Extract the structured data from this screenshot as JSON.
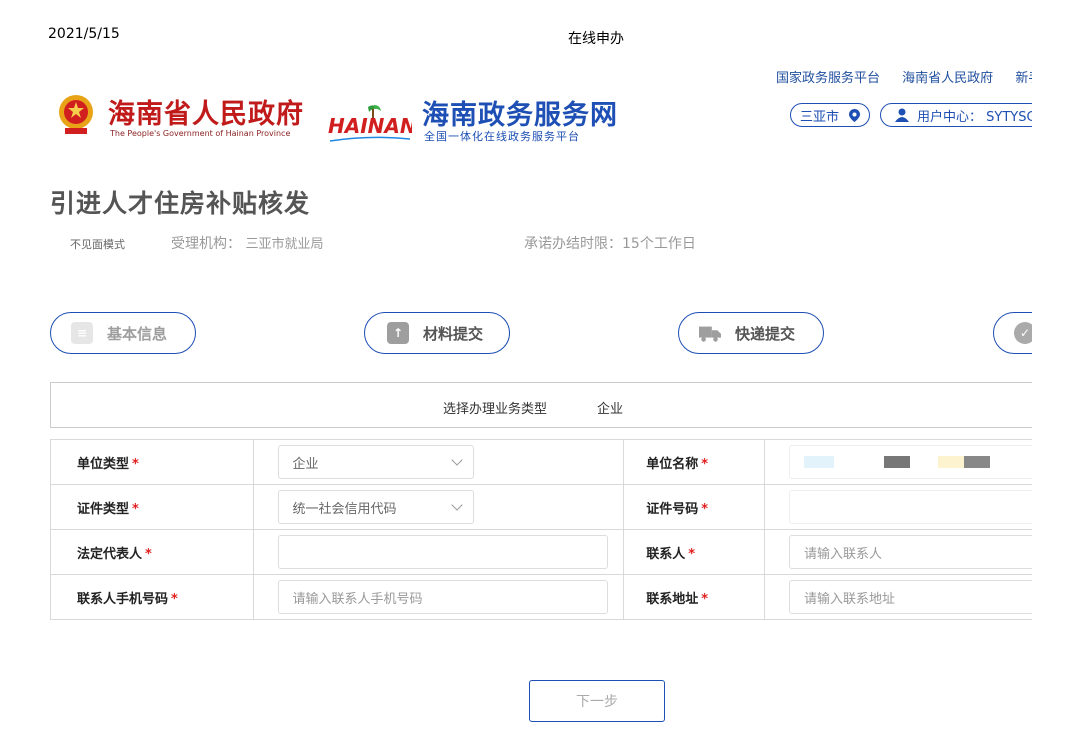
{
  "print_header": {
    "date": "2021/5/15",
    "title": "在线申办"
  },
  "top_links": [
    "国家政务服务平台",
    "海南省人民政府",
    "新手"
  ],
  "gov_logo": {
    "title_cn": "海南省人民政府",
    "title_en": "The People's Government of Hainan Province"
  },
  "portal_logo": {
    "title": "海南政务服务网",
    "subtitle": "全国一体化在线政务服务平台",
    "logo_text": "HAINAN"
  },
  "city_button": "三亚市",
  "user_center": "用户中心： SYTYSC",
  "service": {
    "title": "引进人才住房补贴核发",
    "mode": "不见面模式",
    "org_label": "受理机构：",
    "org_value": "三亚市就业局",
    "time_limit": "承诺办结时限：15个工作日"
  },
  "steps": [
    "基本信息",
    "材料提交",
    "快递提交",
    ""
  ],
  "business_type": {
    "label": "选择办理业务类型",
    "value": "企业"
  },
  "form": {
    "unit_type": {
      "label": "单位类型",
      "value": "企业"
    },
    "unit_name": {
      "label": "单位名称",
      "value": ""
    },
    "cert_type": {
      "label": "证件类型",
      "value": "统一社会信用代码"
    },
    "cert_number": {
      "label": "证件号码",
      "value": ""
    },
    "legal_rep": {
      "label": "法定代表人",
      "value": ""
    },
    "contact": {
      "label": "联系人",
      "placeholder": "请输入联系人"
    },
    "contact_phone": {
      "label": "联系人手机号码",
      "placeholder": "请输入联系人手机号码"
    },
    "contact_address": {
      "label": "联系地址",
      "placeholder": "请输入联系地址"
    }
  },
  "required_mark": "*",
  "next_button": "下一步",
  "colors": {
    "brand_blue": "#1e4fb4",
    "gov_red": "#c01a1a",
    "required": "#e02020"
  }
}
